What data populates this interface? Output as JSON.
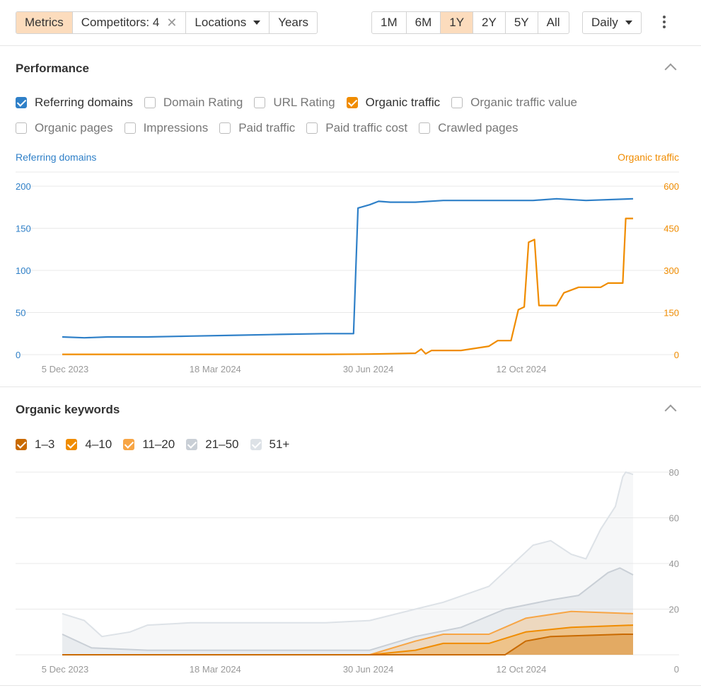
{
  "toolbar": {
    "metrics": "Metrics",
    "competitors": "Competitors: 4",
    "locations": "Locations",
    "years": "Years",
    "ranges": [
      "1M",
      "6M",
      "1Y",
      "2Y",
      "5Y",
      "All"
    ],
    "active_range": "1Y",
    "interval": "Daily"
  },
  "performance": {
    "title": "Performance",
    "checkboxes_row1": [
      {
        "label": "Referring domains",
        "checked": true,
        "color": "#2f80c8"
      },
      {
        "label": "Domain Rating",
        "checked": false
      },
      {
        "label": "URL Rating",
        "checked": false
      },
      {
        "label": "Organic traffic",
        "checked": true,
        "color": "#f08c00"
      },
      {
        "label": "Organic traffic value",
        "checked": false
      }
    ],
    "checkboxes_row2": [
      {
        "label": "Organic pages",
        "checked": false
      },
      {
        "label": "Impressions",
        "checked": false
      },
      {
        "label": "Paid traffic",
        "checked": false
      },
      {
        "label": "Paid traffic cost",
        "checked": false
      },
      {
        "label": "Crawled pages",
        "checked": false
      }
    ],
    "left_axis_label": "Referring domains",
    "right_axis_label": "Organic traffic"
  },
  "keywords": {
    "title": "Organic keywords",
    "checkboxes": [
      {
        "label": "1–3",
        "checked": true,
        "color": "#c96a00"
      },
      {
        "label": "4–10",
        "checked": true,
        "color": "#f08c00"
      },
      {
        "label": "11–20",
        "checked": true,
        "color": "#f7a545"
      },
      {
        "label": "21–50",
        "checked": true,
        "color": "#c9cfd6"
      },
      {
        "label": "51+",
        "checked": true,
        "color": "#dde2e7"
      }
    ]
  },
  "chart_data": [
    {
      "type": "line",
      "x_tick_labels": [
        "5 Dec 2023",
        "18 Mar 2024",
        "30 Jun 2024",
        "12 Oct 2024"
      ],
      "x_range": [
        "2023-12-05",
        "2024-12-27"
      ],
      "y_left": {
        "label": "Referring domains",
        "ticks": [
          0,
          50,
          100,
          150,
          200
        ],
        "range": [
          0,
          200
        ]
      },
      "y_right": {
        "label": "Organic traffic",
        "ticks": [
          0,
          150,
          300,
          450,
          600
        ],
        "range": [
          0,
          600
        ]
      },
      "series": [
        {
          "name": "Referring domains",
          "axis": "left",
          "color": "#2f80c8",
          "points": [
            [
              "2023-12-05",
              21
            ],
            [
              "2023-12-20",
              20
            ],
            [
              "2024-01-05",
              21
            ],
            [
              "2024-02-01",
              21
            ],
            [
              "2024-03-01",
              22
            ],
            [
              "2024-04-01",
              23
            ],
            [
              "2024-05-01",
              24
            ],
            [
              "2024-06-01",
              25
            ],
            [
              "2024-06-20",
              25
            ],
            [
              "2024-06-23",
              174
            ],
            [
              "2024-07-01",
              178
            ],
            [
              "2024-07-07",
              182
            ],
            [
              "2024-07-15",
              181
            ],
            [
              "2024-08-01",
              181
            ],
            [
              "2024-08-20",
              183
            ],
            [
              "2024-09-20",
              183
            ],
            [
              "2024-10-20",
              183
            ],
            [
              "2024-11-05",
              185
            ],
            [
              "2024-11-25",
              183
            ],
            [
              "2024-12-27",
              185
            ]
          ]
        },
        {
          "name": "Organic traffic",
          "axis": "right",
          "color": "#f08c00",
          "points": [
            [
              "2023-12-05",
              1
            ],
            [
              "2024-03-01",
              1
            ],
            [
              "2024-06-01",
              1
            ],
            [
              "2024-07-01",
              2
            ],
            [
              "2024-08-01",
              5
            ],
            [
              "2024-08-05",
              20
            ],
            [
              "2024-08-08",
              3
            ],
            [
              "2024-08-12",
              15
            ],
            [
              "2024-09-01",
              15
            ],
            [
              "2024-09-20",
              30
            ],
            [
              "2024-09-26",
              50
            ],
            [
              "2024-10-05",
              50
            ],
            [
              "2024-10-10",
              160
            ],
            [
              "2024-10-14",
              170
            ],
            [
              "2024-10-17",
              400
            ],
            [
              "2024-10-21",
              410
            ],
            [
              "2024-10-24",
              175
            ],
            [
              "2024-11-01",
              175
            ],
            [
              "2024-11-05",
              175
            ],
            [
              "2024-11-10",
              220
            ],
            [
              "2024-11-20",
              240
            ],
            [
              "2024-12-05",
              240
            ],
            [
              "2024-12-10",
              255
            ],
            [
              "2024-12-20",
              255
            ],
            [
              "2024-12-22",
              485
            ],
            [
              "2024-12-27",
              485
            ]
          ]
        }
      ]
    },
    {
      "type": "area",
      "x_tick_labels": [
        "5 Dec 2023",
        "18 Mar 2024",
        "30 Jun 2024",
        "12 Oct 2024"
      ],
      "x_range": [
        "2023-12-05",
        "2024-12-27"
      ],
      "y": {
        "ticks": [
          0,
          20,
          40,
          60,
          80
        ],
        "range": [
          0,
          80
        ]
      },
      "series": [
        {
          "name": "1–3",
          "color": "#c96a00",
          "points": [
            [
              "2023-12-05",
              0
            ],
            [
              "2024-08-20",
              0
            ],
            [
              "2024-10-01",
              0
            ],
            [
              "2024-10-15",
              6
            ],
            [
              "2024-11-01",
              8
            ],
            [
              "2024-12-20",
              9
            ],
            [
              "2024-12-27",
              9
            ]
          ]
        },
        {
          "name": "4–10",
          "color": "#f08c00",
          "points": [
            [
              "2023-12-05",
              0
            ],
            [
              "2024-07-01",
              0
            ],
            [
              "2024-08-01",
              2
            ],
            [
              "2024-08-20",
              5
            ],
            [
              "2024-09-20",
              5
            ],
            [
              "2024-10-15",
              10
            ],
            [
              "2024-11-15",
              12
            ],
            [
              "2024-12-27",
              13
            ]
          ]
        },
        {
          "name": "11–20",
          "color": "#f7a545",
          "points": [
            [
              "2023-12-05",
              0
            ],
            [
              "2024-07-01",
              0
            ],
            [
              "2024-08-01",
              6
            ],
            [
              "2024-08-20",
              9
            ],
            [
              "2024-09-20",
              9
            ],
            [
              "2024-10-15",
              16
            ],
            [
              "2024-11-15",
              19
            ],
            [
              "2024-12-27",
              18
            ]
          ]
        },
        {
          "name": "21–50",
          "color": "#c9cfd6",
          "points": [
            [
              "2023-12-05",
              9
            ],
            [
              "2023-12-25",
              3
            ],
            [
              "2024-02-01",
              2
            ],
            [
              "2024-06-10",
              2
            ],
            [
              "2024-07-01",
              2
            ],
            [
              "2024-08-01",
              8
            ],
            [
              "2024-09-01",
              12
            ],
            [
              "2024-10-01",
              20
            ],
            [
              "2024-11-01",
              24
            ],
            [
              "2024-11-20",
              26
            ],
            [
              "2024-12-10",
              36
            ],
            [
              "2024-12-18",
              38
            ],
            [
              "2024-12-27",
              35
            ]
          ]
        },
        {
          "name": "51+",
          "color": "#dde2e7",
          "points": [
            [
              "2023-12-05",
              18
            ],
            [
              "2023-12-20",
              15
            ],
            [
              "2024-01-01",
              8
            ],
            [
              "2024-01-20",
              10
            ],
            [
              "2024-02-01",
              13
            ],
            [
              "2024-03-01",
              14
            ],
            [
              "2024-04-15",
              14
            ],
            [
              "2024-06-01",
              14
            ],
            [
              "2024-07-01",
              15
            ],
            [
              "2024-08-01",
              20
            ],
            [
              "2024-08-20",
              23
            ],
            [
              "2024-09-20",
              30
            ],
            [
              "2024-10-20",
              48
            ],
            [
              "2024-11-01",
              50
            ],
            [
              "2024-11-15",
              44
            ],
            [
              "2024-11-25",
              42
            ],
            [
              "2024-12-05",
              55
            ],
            [
              "2024-12-15",
              65
            ],
            [
              "2024-12-20",
              78
            ],
            [
              "2024-12-22",
              80
            ],
            [
              "2024-12-27",
              79
            ]
          ]
        }
      ]
    }
  ]
}
